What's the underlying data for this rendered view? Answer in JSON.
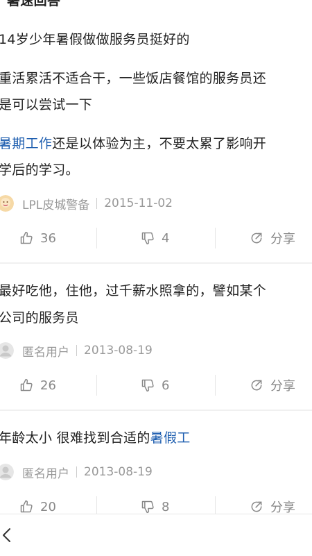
{
  "header": {
    "title_fragment": "暑速回答"
  },
  "question": {
    "title": "14岁少年暑假做做服务员挺好的"
  },
  "answers": [
    {
      "lines": [
        [
          "重活累活不适合干，一些饭店餐馆的服务员还"
        ],
        [
          "是可以尝试一下"
        ],
        [
          "",
          "暑期工作",
          "还是以体验为主，不要太累了影响开"
        ],
        [
          "学后的学习。"
        ]
      ],
      "author": "LPL皮城警备",
      "date": "2015-11-02",
      "likes": "36",
      "dislikes": "4",
      "share": "分享"
    },
    {
      "lines": [
        [
          "最好吃他，住他，过千薪水照拿的，譬如某个"
        ],
        [
          "公司的服务员"
        ]
      ],
      "author": "匿名用户",
      "date": "2013-08-19",
      "likes": "26",
      "dislikes": "6",
      "share": "分享"
    },
    {
      "lines": [
        [
          "年龄太小 很难找到合适的",
          "暑假工"
        ]
      ],
      "author": "匿名用户",
      "date": "2013-08-19",
      "likes": "20",
      "dislikes": "8",
      "share": "分享"
    }
  ],
  "colors": {
    "link": "#1f5fb0",
    "meta": "#999999",
    "divider": "#f0f0f0"
  },
  "icons": [
    "thumbs-up-icon",
    "thumbs-down-icon",
    "share-icon",
    "back-chevron-icon",
    "avatar-icon"
  ]
}
